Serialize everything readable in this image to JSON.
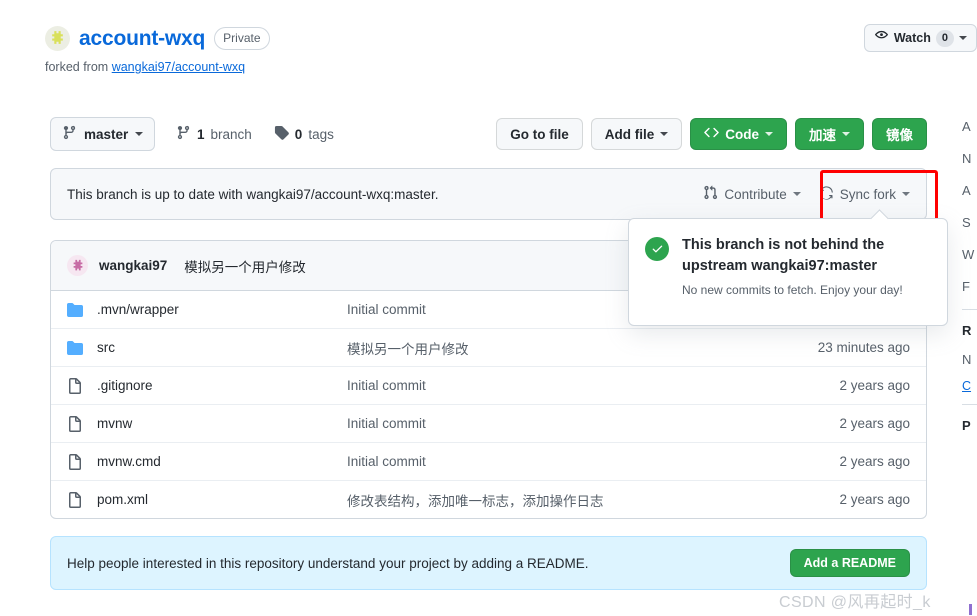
{
  "header": {
    "repo_name": "account-wxq",
    "visibility": "Private",
    "forked_from_label": "forked from",
    "forked_from_link": "wangkai97/account-wxq",
    "watch_label": "Watch",
    "watch_count": "0",
    "repo_avatar_icon": "repo-avatar-icon",
    "eye_icon": "eye-icon"
  },
  "toolbar": {
    "branch_name": "master",
    "branch_icon": "branch-icon",
    "branch_count_value": "1",
    "branch_count_label": "branch",
    "tag_count_value": "0",
    "tag_count_label": "tags",
    "tag_icon": "tag-icon",
    "go_to_file": "Go to file",
    "add_file": "Add file",
    "code": "Code",
    "code_icon": "code-brackets-icon",
    "accelerate": "加速",
    "mirror": "镜像"
  },
  "sync_bar": {
    "status_text": "This branch is up to date with wangkai97/account-wxq:master.",
    "contribute_label": "Contribute",
    "contribute_icon": "git-pull-request-icon",
    "sync_fork_label": "Sync fork",
    "sync_fork_icon": "sync-icon",
    "highlight_color": "#ff0000"
  },
  "sync_popup": {
    "check_icon": "check-circle-icon",
    "title": "This branch is not behind the upstream wangkai97:master",
    "subtitle": "No new commits to fetch. Enjoy your day!",
    "accent_color": "#2da44e"
  },
  "commit_bar": {
    "avatar_icon": "user-avatar-icon",
    "author": "wangkai97",
    "message": "模拟另一个用户修改"
  },
  "files": {
    "rows": [
      {
        "icon": "folder-icon",
        "name": ".mvn/wrapper",
        "commit": "Initial commit",
        "time": ""
      },
      {
        "icon": "folder-icon",
        "name": "src",
        "commit": "模拟另一个用户修改",
        "time": "23 minutes ago"
      },
      {
        "icon": "file-icon",
        "name": ".gitignore",
        "commit": "Initial commit",
        "time": "2 years ago"
      },
      {
        "icon": "file-icon",
        "name": "mvnw",
        "commit": "Initial commit",
        "time": "2 years ago"
      },
      {
        "icon": "file-icon",
        "name": "mvnw.cmd",
        "commit": "Initial commit",
        "time": "2 years ago"
      },
      {
        "icon": "file-icon",
        "name": "pom.xml",
        "commit": "修改表结构，添加唯一标志，添加操作日志",
        "time": "2 years ago"
      }
    ]
  },
  "readme_banner": {
    "text": "Help people interested in this repository understand your project by adding a README.",
    "button_label": "Add a README",
    "button_color": "#2da44e"
  },
  "right_rail": {
    "items": [
      "A",
      "N",
      "A",
      "S",
      "W",
      "F"
    ],
    "heading": "R",
    "no_label": "N",
    "link_label": "C",
    "packages_label": "P"
  },
  "watermark": {
    "text": "CSDN @风再起时_k"
  }
}
